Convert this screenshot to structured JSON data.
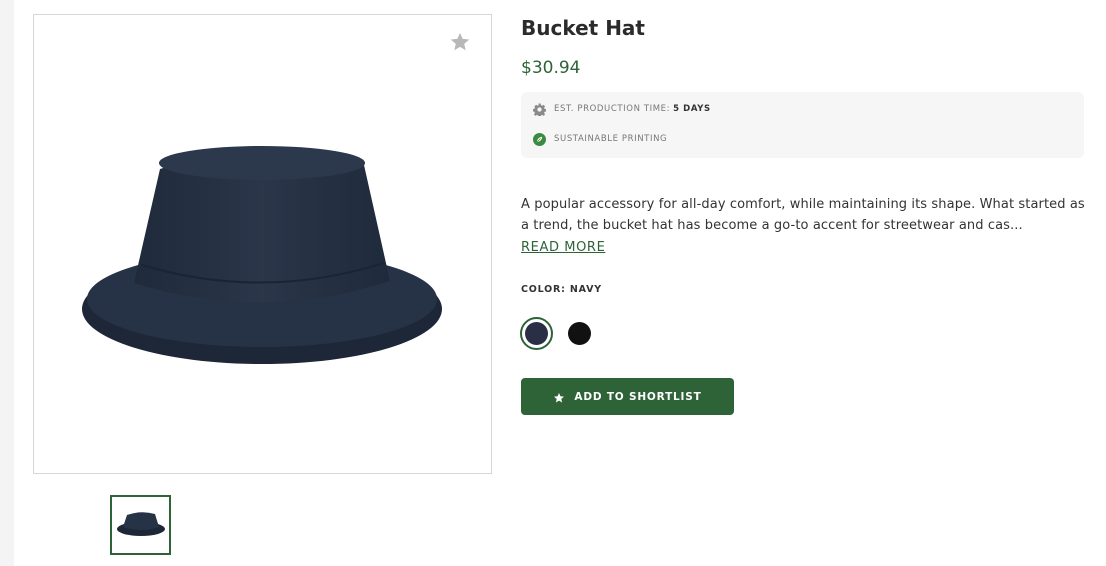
{
  "product": {
    "title": "Bucket Hat",
    "price": "$30.94",
    "production_time_label": "EST. PRODUCTION TIME:",
    "production_time_value": "5 DAYS",
    "sustainable_label": "SUSTAINABLE PRINTING",
    "description": "A popular accessory for all-day comfort, while maintaining its shape. What started as a trend, the bucket hat has become a go-to accent for streetwear and cas...",
    "read_more": "READ MORE",
    "color_label": "COLOR: NAVY",
    "colors": [
      {
        "name": "navy",
        "hex": "#2b2f45",
        "selected": true
      },
      {
        "name": "black",
        "hex": "#111111",
        "selected": false
      }
    ],
    "add_button_label": "ADD TO SHORTLIST"
  },
  "icons": {
    "favorite": "star-icon",
    "production": "gear-icon",
    "sustainable": "leaf-icon",
    "add": "star-icon"
  },
  "theme": {
    "accent": "#2e6337",
    "hat_color": "#263347"
  }
}
